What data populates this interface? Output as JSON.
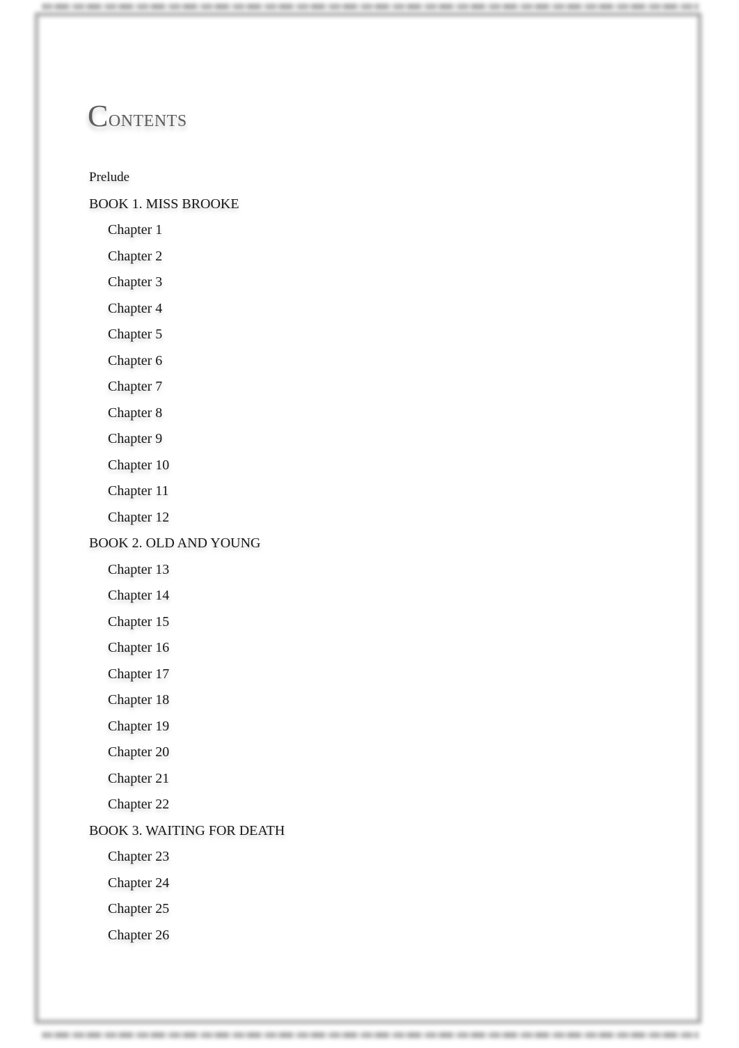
{
  "document": {
    "title": "Contents",
    "title_initial": "C",
    "title_rest": "ontents",
    "title_color": "#5c5c5c",
    "text_color": "#161616",
    "frame_color": "#9a9a9a"
  },
  "toc": {
    "entries": [
      {
        "label": "Prelude",
        "level": 0,
        "kind": "front-matter"
      },
      {
        "label": "BOOK 1. MISS BROOKE",
        "level": 0,
        "kind": "book"
      },
      {
        "label": "Chapter 1",
        "level": 1,
        "kind": "chapter"
      },
      {
        "label": "Chapter 2",
        "level": 1,
        "kind": "chapter"
      },
      {
        "label": "Chapter 3",
        "level": 1,
        "kind": "chapter"
      },
      {
        "label": "Chapter 4",
        "level": 1,
        "kind": "chapter"
      },
      {
        "label": "Chapter 5",
        "level": 1,
        "kind": "chapter"
      },
      {
        "label": "Chapter 6",
        "level": 1,
        "kind": "chapter"
      },
      {
        "label": "Chapter 7",
        "level": 1,
        "kind": "chapter"
      },
      {
        "label": "Chapter 8",
        "level": 1,
        "kind": "chapter"
      },
      {
        "label": "Chapter 9",
        "level": 1,
        "kind": "chapter"
      },
      {
        "label": "Chapter 10",
        "level": 1,
        "kind": "chapter"
      },
      {
        "label": "Chapter 11",
        "level": 1,
        "kind": "chapter"
      },
      {
        "label": "Chapter 12",
        "level": 1,
        "kind": "chapter"
      },
      {
        "label": "BOOK 2. OLD AND YOUNG",
        "level": 0,
        "kind": "book"
      },
      {
        "label": "Chapter 13",
        "level": 1,
        "kind": "chapter"
      },
      {
        "label": "Chapter 14",
        "level": 1,
        "kind": "chapter"
      },
      {
        "label": "Chapter 15",
        "level": 1,
        "kind": "chapter"
      },
      {
        "label": "Chapter 16",
        "level": 1,
        "kind": "chapter"
      },
      {
        "label": "Chapter 17",
        "level": 1,
        "kind": "chapter"
      },
      {
        "label": "Chapter 18",
        "level": 1,
        "kind": "chapter"
      },
      {
        "label": "Chapter 19",
        "level": 1,
        "kind": "chapter"
      },
      {
        "label": "Chapter 20",
        "level": 1,
        "kind": "chapter"
      },
      {
        "label": "Chapter 21",
        "level": 1,
        "kind": "chapter"
      },
      {
        "label": "Chapter 22",
        "level": 1,
        "kind": "chapter"
      },
      {
        "label": "BOOK 3. WAITING FOR DEATH",
        "level": 0,
        "kind": "book"
      },
      {
        "label": "Chapter 23",
        "level": 1,
        "kind": "chapter"
      },
      {
        "label": "Chapter 24",
        "level": 1,
        "kind": "chapter"
      },
      {
        "label": "Chapter 25",
        "level": 1,
        "kind": "chapter"
      },
      {
        "label": "Chapter 26",
        "level": 1,
        "kind": "chapter"
      }
    ]
  }
}
